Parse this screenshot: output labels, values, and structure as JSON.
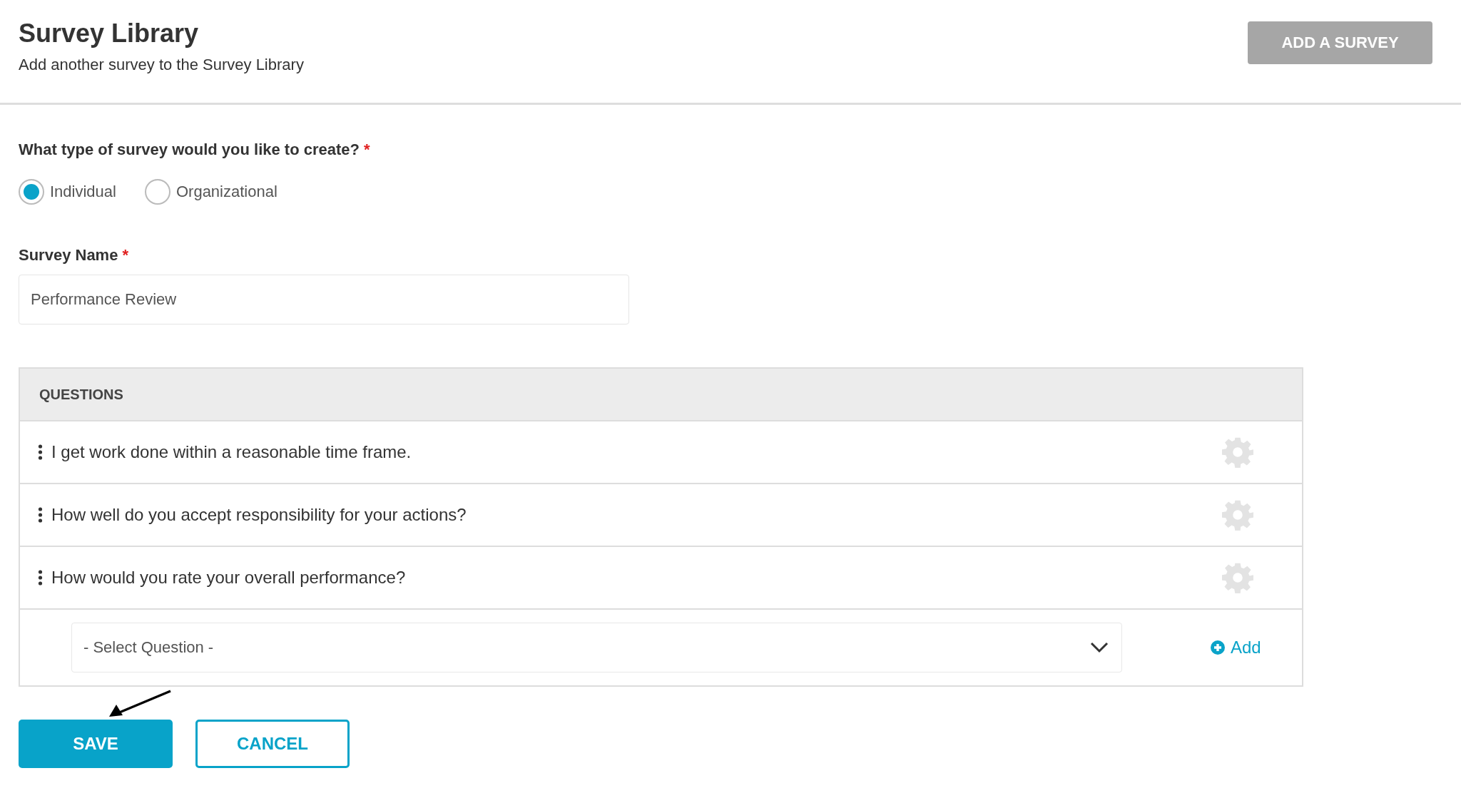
{
  "header": {
    "title": "Survey Library",
    "subtitle": "Add another survey to the Survey Library",
    "add_button": "ADD A SURVEY"
  },
  "survey_type": {
    "label": "What type of survey would you like to create?",
    "required_mark": "*",
    "options": [
      {
        "label": "Individual",
        "selected": true
      },
      {
        "label": "Organizational",
        "selected": false
      }
    ]
  },
  "survey_name": {
    "label": "Survey Name",
    "required_mark": "*",
    "value": "Performance Review"
  },
  "questions": {
    "heading": "QUESTIONS",
    "items": [
      {
        "text": "I get work done within a reasonable time frame."
      },
      {
        "text": "How well do you accept responsibility for your actions?"
      },
      {
        "text": "How would you rate your overall performance?"
      }
    ],
    "select": {
      "placeholder": "- Select Question -"
    },
    "add_label": "Add"
  },
  "buttons": {
    "save": "SAVE",
    "cancel": "CANCEL"
  }
}
